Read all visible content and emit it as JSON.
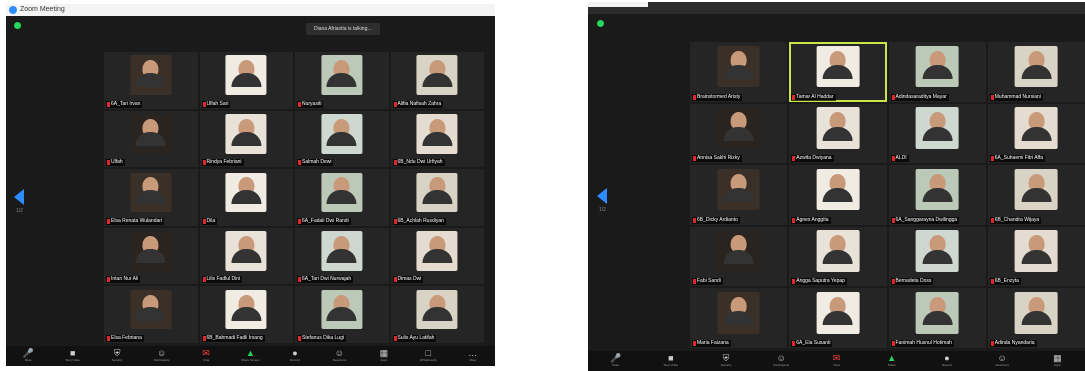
{
  "left": {
    "title": "Zoom Meeting",
    "toast": "Diana Afrianita is talking...",
    "page": "1/2",
    "tiles": [
      "6A_Tari Irvan",
      "Ulfah Sari",
      "Nuryasiti",
      "Alifia Nafisah Zahra",
      "Ulfah",
      "Rindya Febriani",
      "Salmah Dewi",
      "6B_Ndu Dwi Urfiyah",
      "Elsa Renata Wulandari",
      "Dila",
      "6A_Fadali Dwi Randi",
      "6B_Achlah Rusdiyan",
      "Intan Nur Ali",
      "Lilis Fadlul Dini",
      "6A_Tari Dwi Nurwajah",
      "Dimas Dwi",
      "Elsa Febriana",
      "6B_Bahmadi Fadli Irsang",
      "Stefanus Dika Lugi",
      "Sulis Ayu Latifah"
    ],
    "toolbar": [
      {
        "icon": "mic-icon",
        "label": "Mute"
      },
      {
        "icon": "video-icon",
        "label": "Stop Video"
      },
      {
        "icon": "security-icon",
        "label": "Security"
      },
      {
        "icon": "participants-icon",
        "label": "Participants"
      },
      {
        "icon": "chat-icon",
        "label": "Chat"
      },
      {
        "icon": "share-screen-icon",
        "label": "Share Screen"
      },
      {
        "icon": "record-icon",
        "label": "Record"
      },
      {
        "icon": "reactions-icon",
        "label": "Reactions"
      },
      {
        "icon": "apps-icon",
        "label": "Apps"
      },
      {
        "icon": "whiteboard-icon",
        "label": "Whiteboards"
      },
      {
        "icon": "more-icon",
        "label": "More"
      }
    ]
  },
  "right": {
    "page": "1/2",
    "tiles": [
      "Brainstormed Aristy",
      "Tamar Al Haddar",
      "Adindasaraditya Mayar",
      "Muhammad Nursiani",
      "Annisa Sakhi Rizky",
      "Azwita Dwiyana",
      "ALDI",
      "6A_Suhaemi Fitri Affa",
      "6B_Dicky Ardianto",
      "Agnes Anggita",
      "6A_Sanggarayna Dwilingga",
      "6B_Chandra Wijaya",
      "Fabi Sandi",
      "Angga Saputra Yepap",
      "Bernadeta Doss",
      "6B_Enzyta",
      "Maria Faizana",
      "6A_Ela Susanti",
      "Fanimah Husnul Hotimah",
      "Adinda Nyandaria"
    ],
    "toolbar": [
      {
        "icon": "mic-icon",
        "label": "Mute"
      },
      {
        "icon": "video-icon",
        "label": "Stop Video"
      },
      {
        "icon": "security-icon",
        "label": "Security"
      },
      {
        "icon": "participants-icon",
        "label": "Participants"
      },
      {
        "icon": "chat-icon",
        "label": "Chat"
      },
      {
        "icon": "share-screen-icon",
        "label": "Share"
      },
      {
        "icon": "record-icon",
        "label": "Record"
      },
      {
        "icon": "reactions-icon",
        "label": "Reactions"
      },
      {
        "icon": "apps-icon",
        "label": "Apps"
      }
    ]
  },
  "colors": {
    "accent": "#2d8cff",
    "shield": "#23d959",
    "speaker": "#c8e64a",
    "name_flag": "#e02828"
  }
}
